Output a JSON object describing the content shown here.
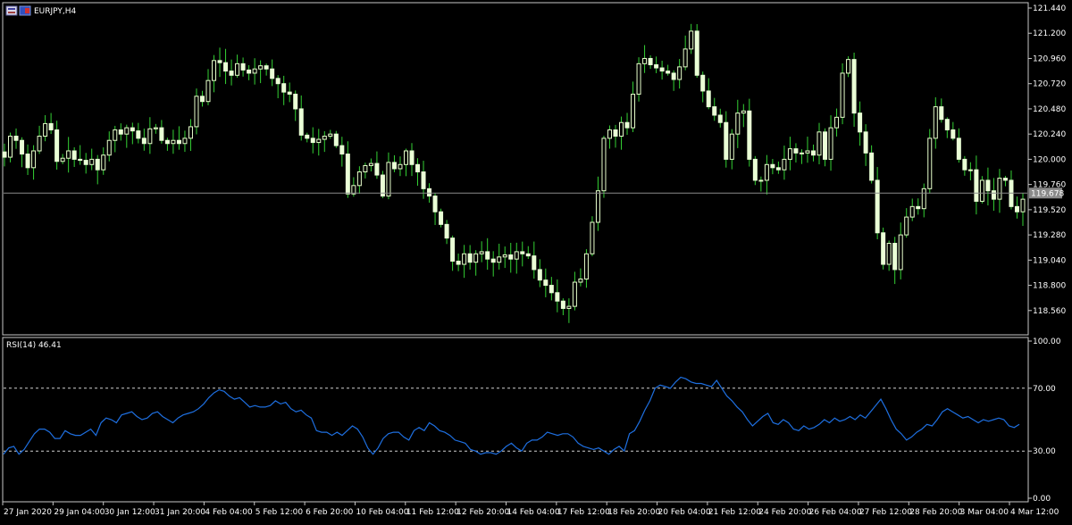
{
  "header": {
    "symbol_label": "EURJPY,H4"
  },
  "colors": {
    "background": "#000000",
    "frame": "#c8c8c8",
    "bull_body": "#000000",
    "bull_outline": "#e8ffcc",
    "bull_fill": "#000000",
    "bear_fill": "#eaffd6",
    "wick": "#34d134",
    "rsi_line": "#1e6fe0",
    "level_line": "#d0d0d0",
    "price_line": "#8a8a8a",
    "price_tag_bg": "#8a8a8a",
    "text": "#ffffff"
  },
  "chart_data": [
    {
      "type": "candlestick",
      "title": "EURJPY,H4",
      "ylim": [
        118.4,
        121.48
      ],
      "y_ticks": [
        "121.440",
        "121.200",
        "120.960",
        "120.720",
        "120.480",
        "120.240",
        "120.000",
        "119.760",
        "119.520",
        "119.280",
        "119.040",
        "118.800",
        "118.560"
      ],
      "current_price": "119.678",
      "x_ticks": [
        "27 Jan 2020",
        "29 Jan 04:00",
        "30 Jan 12:00",
        "31 Jan 20:00",
        "4 Feb 04:00",
        "5 Feb 12:00",
        "6 Feb 20:00",
        "10 Feb 04:00",
        "11 Feb 12:00",
        "12 Feb 20:00",
        "14 Feb 04:00",
        "17 Feb 12:00",
        "18 Feb 20:00",
        "20 Feb 04:00",
        "21 Feb 12:00",
        "24 Feb 20:00",
        "26 Feb 04:00",
        "27 Feb 12:00",
        "28 Feb 20:00",
        "3 Mar 04:00",
        "4 Mar 12:00"
      ],
      "close": [
        120.02,
        120.22,
        120.18,
        120.05,
        119.92,
        120.08,
        120.22,
        120.34,
        120.28,
        119.98,
        120.01,
        120.08,
        120.0,
        119.99,
        119.95,
        120.0,
        119.9,
        120.04,
        120.18,
        120.28,
        120.24,
        120.3,
        120.27,
        120.2,
        120.15,
        120.29,
        120.3,
        120.18,
        120.15,
        120.18,
        120.15,
        120.2,
        120.31,
        120.6,
        120.55,
        120.75,
        120.94,
        120.92,
        120.84,
        120.8,
        120.91,
        120.85,
        120.82,
        120.86,
        120.89,
        120.86,
        120.77,
        120.72,
        120.64,
        120.62,
        120.48,
        120.23,
        120.2,
        120.16,
        120.19,
        120.22,
        120.24,
        120.13,
        120.05,
        119.67,
        119.75,
        119.88,
        119.94,
        119.96,
        119.85,
        119.65,
        119.97,
        119.91,
        119.95,
        120.08,
        119.95,
        119.88,
        119.72,
        119.65,
        119.5,
        119.38,
        119.25,
        119.03,
        119.0,
        119.1,
        119.02,
        119.1,
        119.12,
        119.05,
        119.02,
        119.07,
        119.09,
        119.05,
        119.12,
        119.1,
        119.08,
        118.95,
        118.85,
        118.8,
        118.73,
        118.65,
        118.58,
        118.6,
        118.83,
        118.86,
        119.1,
        119.4,
        119.7,
        120.2,
        120.28,
        120.22,
        120.35,
        120.3,
        120.62,
        120.91,
        120.96,
        120.9,
        120.87,
        120.84,
        120.82,
        120.76,
        120.88,
        121.05,
        121.22,
        120.8,
        120.65,
        120.5,
        120.42,
        120.35,
        120.0,
        120.24,
        120.44,
        120.46,
        120.0,
        119.8,
        119.8,
        119.95,
        119.92,
        119.9,
        120.0,
        120.1,
        120.06,
        120.06,
        120.08,
        120.04,
        120.26,
        120.0,
        120.3,
        120.4,
        120.82,
        120.95,
        120.44,
        120.26,
        120.06,
        119.8,
        119.3,
        119.0,
        119.2,
        118.95,
        119.28,
        119.45,
        119.55,
        119.53,
        119.72,
        120.2,
        120.5,
        120.38,
        120.28,
        120.2,
        120.0,
        119.9,
        119.9,
        119.6,
        119.8,
        119.7,
        119.62,
        119.82,
        119.8,
        119.55,
        119.5,
        119.62
      ]
    },
    {
      "type": "line",
      "title": "RSI(14) 46.41",
      "indicator_label": "RSI(14) 46.41",
      "ylim": [
        0,
        100
      ],
      "y_ticks": [
        "100.00",
        "70.00",
        "30.00",
        "0.00"
      ],
      "levels": [
        70,
        30
      ],
      "values": [
        28.0,
        32.0,
        33.0,
        28.0,
        31.0,
        36.0,
        41.0,
        44.0,
        44.0,
        42.0,
        38.0,
        38.0,
        43.0,
        41.0,
        40.0,
        40.0,
        42.0,
        44.0,
        40.0,
        48.0,
        51.0,
        50.0,
        48.0,
        53.0,
        54.0,
        55.0,
        52.0,
        50.0,
        51.0,
        54.0,
        55.0,
        52.0,
        50.0,
        48.0,
        51.0,
        53.0,
        54.0,
        55.0,
        57.0,
        60.0,
        64.0,
        67.0,
        69.0,
        68.0,
        65.0,
        63.0,
        64.0,
        61.0,
        58.0,
        59.0,
        58.0,
        58.0,
        59.0,
        62.0,
        60.0,
        61.0,
        57.0,
        55.0,
        56.0,
        53.0,
        51.0,
        43.0,
        42.0,
        42.0,
        40.0,
        42.0,
        40.0,
        43.0,
        46.0,
        44.0,
        39.0,
        32.0,
        28.0,
        32.0,
        38.0,
        41.0,
        42.0,
        42.0,
        39.0,
        37.0,
        43.0,
        45.0,
        43.0,
        48.0,
        46.0,
        43.0,
        42.0,
        40.0,
        37.0,
        36.0,
        35.0,
        31.0,
        30.0,
        28.0,
        29.0,
        29.0,
        28.0,
        30.0,
        33.0,
        35.0,
        32.0,
        30.0,
        35.0,
        37.0,
        37.0,
        39.0,
        42.0,
        41.0,
        40.0,
        41.0,
        41.0,
        39.0,
        35.0,
        33.0,
        32.0,
        31.0,
        32.0,
        30.0,
        28.0,
        31.0,
        33.0,
        30.0,
        41.0,
        43.0,
        49.0,
        56.0,
        62.0,
        70.0,
        72.0,
        71.0,
        70.0,
        74.0,
        77.0,
        76.0,
        74.0,
        73.0,
        73.0,
        72.0,
        71.0,
        75.0,
        70.0,
        65.0,
        62.0,
        58.0,
        55.0,
        50.0,
        46.0,
        49.0,
        52.0,
        54.0,
        48.0,
        47.0,
        50.0,
        48.0,
        44.0,
        43.0,
        46.0,
        44.0,
        45.0,
        47.0,
        50.0,
        48.0,
        51.0,
        49.0,
        50.0,
        52.0,
        50.0,
        53.0,
        51.0,
        55.0,
        59.0,
        63.0,
        57.0,
        50.0,
        44.0,
        41.0,
        37.0,
        39.0,
        42.0,
        44.0,
        47.0,
        46.0,
        50.0,
        55.0,
        57.0,
        55.0,
        53.0,
        51.0,
        52.0,
        50.0,
        48.0,
        50.0,
        49.0,
        50.0,
        51.0,
        50.0,
        46.0,
        45.0,
        47.0
      ]
    }
  ]
}
